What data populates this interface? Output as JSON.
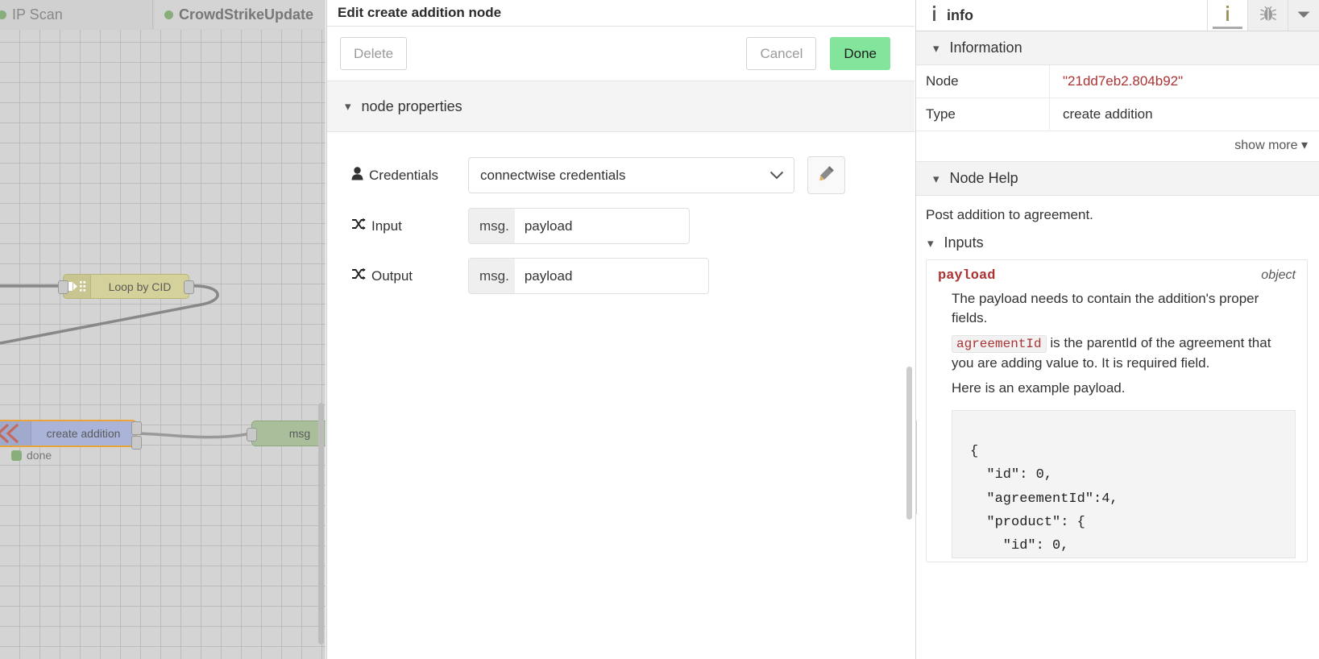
{
  "canvas": {
    "flow_tabs": [
      {
        "label": "IP Scan",
        "status_color": "#8aad7c",
        "active": false
      },
      {
        "label": "CrowdStrikeUpdate",
        "status_color": "#8aad7c",
        "active": true
      }
    ],
    "nodes": [
      {
        "label": "Loop by CID",
        "color": "#d4d19a",
        "icon": "split-loop-icon"
      },
      {
        "label": "create addition",
        "color": "#a9b4d8",
        "icon": "chevrons-left-icon",
        "selected": true
      },
      {
        "label": "msg",
        "color": "#a9bf9b",
        "icon": "debug-icon"
      }
    ],
    "node_status": {
      "label": "done",
      "color": "#8aad7c"
    }
  },
  "dialog": {
    "title": "Edit create addition node",
    "delete_label": "Delete",
    "cancel_label": "Cancel",
    "done_label": "Done",
    "done_color": "#83e59b",
    "section_label": "node properties",
    "fields": {
      "credentials": {
        "label": "Credentials",
        "icon": "user-icon",
        "value": "connectwise credentials",
        "edit_icon": "pencil-icon",
        "chevron": "chevron-down-icon"
      },
      "input": {
        "label": "Input",
        "icon": "shuffle-icon",
        "prefix": "msg.",
        "value": "payload",
        "placeholder": "payload"
      },
      "output": {
        "label": "Output",
        "icon": "shuffle-icon",
        "prefix": "msg.",
        "value": "payload",
        "placeholder": "payload"
      }
    }
  },
  "sidebar": {
    "title": "info",
    "title_icon": "info-icon",
    "tabs": [
      {
        "name": "info-tab",
        "icon": "info-icon",
        "active": true
      },
      {
        "name": "debug-tab",
        "icon": "bug-icon",
        "active": false
      }
    ],
    "menu_icon": "chevron-down-icon",
    "information": {
      "section_label": "Information",
      "rows": [
        {
          "key": "Node",
          "value": "\"21dd7eb2.804b92\"",
          "quoted": true
        },
        {
          "key": "Type",
          "value": "create addition",
          "quoted": false
        }
      ],
      "show_more": "show more"
    },
    "node_help": {
      "section_label": "Node Help",
      "description": "Post addition to agreement.",
      "inputs_label": "Inputs",
      "property": {
        "name": "payload",
        "type": "object",
        "paragraph_1": "The payload needs to contain the addition's proper fields.",
        "inline_code": "agreementId",
        "paragraph_2": "is the parentId of the agreement that you are adding value to. It is required field.",
        "paragraph_3": "Here is an example payload.",
        "code_block": "{\n  \"id\": 0,\n  \"agreementId\":4,\n  \"product\": {\n    \"id\": 0,"
      }
    }
  }
}
